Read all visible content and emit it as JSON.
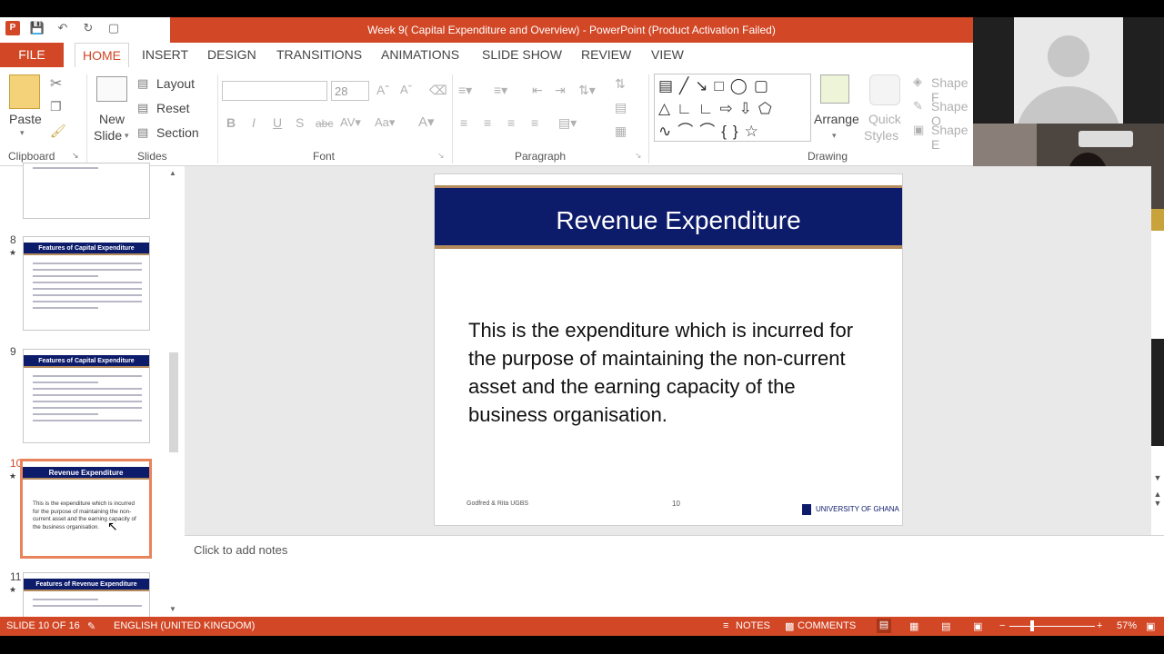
{
  "window": {
    "title": "Week 9( Capital Expenditure and Overview) -  PowerPoint (Product Activation Failed)"
  },
  "tabs": [
    "FILE",
    "HOME",
    "INSERT",
    "DESIGN",
    "TRANSITIONS",
    "ANIMATIONS",
    "SLIDE SHOW",
    "REVIEW",
    "VIEW"
  ],
  "ribbon": {
    "paste": "Paste",
    "new_slide_1": "New",
    "new_slide_2": "Slide",
    "layout": "Layout",
    "reset": "Reset",
    "section": "Section",
    "font_size": "28",
    "arrange": "Arrange",
    "quick_styles_1": "Quick",
    "quick_styles_2": "Styles",
    "shape_fill": "Shape F",
    "shape_outline": "Shape O",
    "shape_effects": "Shape E",
    "groups": {
      "clipboard": "Clipboard",
      "slides": "Slides",
      "font": "Font",
      "paragraph": "Paragraph",
      "drawing": "Drawing"
    }
  },
  "thumbnails": [
    {
      "number": "8",
      "title": "Features of Capital Expenditure"
    },
    {
      "number": "9",
      "title": "Features of Capital Expenditure"
    },
    {
      "number": "10",
      "title": "Revenue Expenditure",
      "text": "This is the expenditure which is incurred for the purpose of maintaining the non-current asset and the earning capacity of the business organisation."
    },
    {
      "number": "11",
      "title": "Features of Revenue Expenditure"
    }
  ],
  "slide": {
    "title": "Revenue Expenditure",
    "body": "This is the expenditure which is incurred for the purpose of maintaining the non-current asset and the earning capacity of the business organisation.",
    "footer_left": "Godfred & Rita UGBS",
    "footer_number": "10",
    "footer_logo": "UNIVERSITY OF GHANA"
  },
  "notes_placeholder": "Click to add notes",
  "status": {
    "slide_info": "SLIDE 10 OF 16",
    "language": "ENGLISH (UNITED KINGDOM)",
    "notes": "NOTES",
    "comments": "COMMENTS",
    "zoom": "57%"
  },
  "colors": {
    "accent": "#d24726",
    "slide_banner": "#0d1b6b",
    "banner_trim": "#b38b5d"
  }
}
